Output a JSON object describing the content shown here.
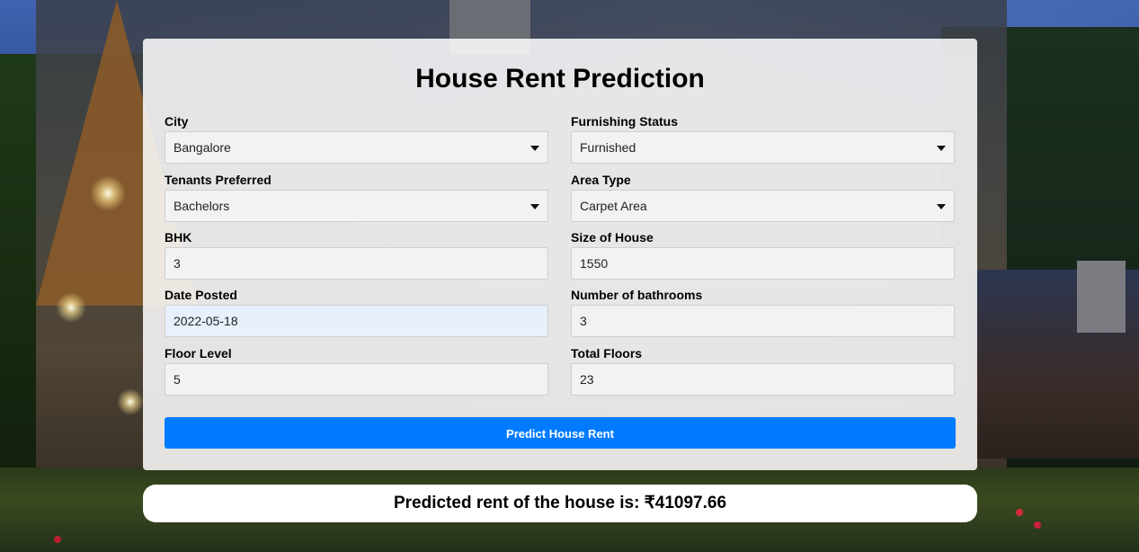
{
  "page": {
    "title": "House Rent Prediction"
  },
  "form": {
    "city": {
      "label": "City",
      "value": "Bangalore"
    },
    "furnishing_status": {
      "label": "Furnishing Status",
      "value": "Furnished"
    },
    "tenants_preferred": {
      "label": "Tenants Preferred",
      "value": "Bachelors"
    },
    "area_type": {
      "label": "Area Type",
      "value": "Carpet Area"
    },
    "bhk": {
      "label": "BHK",
      "value": "3"
    },
    "size_of_house": {
      "label": "Size of House",
      "value": "1550"
    },
    "date_posted": {
      "label": "Date Posted",
      "value": "2022-05-18"
    },
    "number_of_bathrooms": {
      "label": "Number of bathrooms",
      "value": "3"
    },
    "floor_level": {
      "label": "Floor Level",
      "value": "5"
    },
    "total_floors": {
      "label": "Total Floors",
      "value": "23"
    },
    "submit_label": "Predict House Rent"
  },
  "result": {
    "text": "Predicted rent of the house is: ₹41097.66"
  },
  "colors": {
    "primary_button": "#007bff",
    "date_field_bg": "#e8f0fe"
  }
}
